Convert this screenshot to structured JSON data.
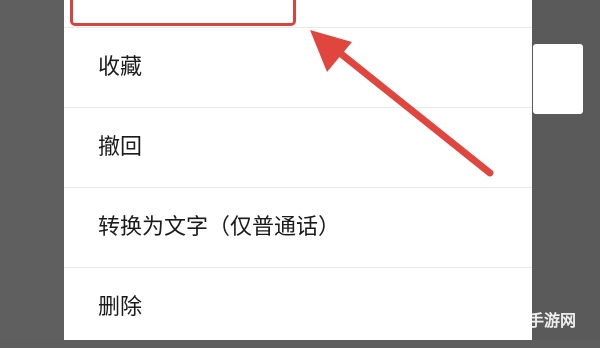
{
  "background_bubble": {
    "text": ""
  },
  "menu": {
    "items": [
      {
        "label": "",
        "highlighted": true
      },
      {
        "label": "收藏"
      },
      {
        "label": "撤回"
      },
      {
        "label": "转换为文字（仅普通话）"
      },
      {
        "label": "删除"
      }
    ]
  },
  "annotation": {
    "highlight_color": "#d8453f",
    "arrow_color": "#e0463e"
  },
  "watermark": {
    "text": "手游网"
  }
}
